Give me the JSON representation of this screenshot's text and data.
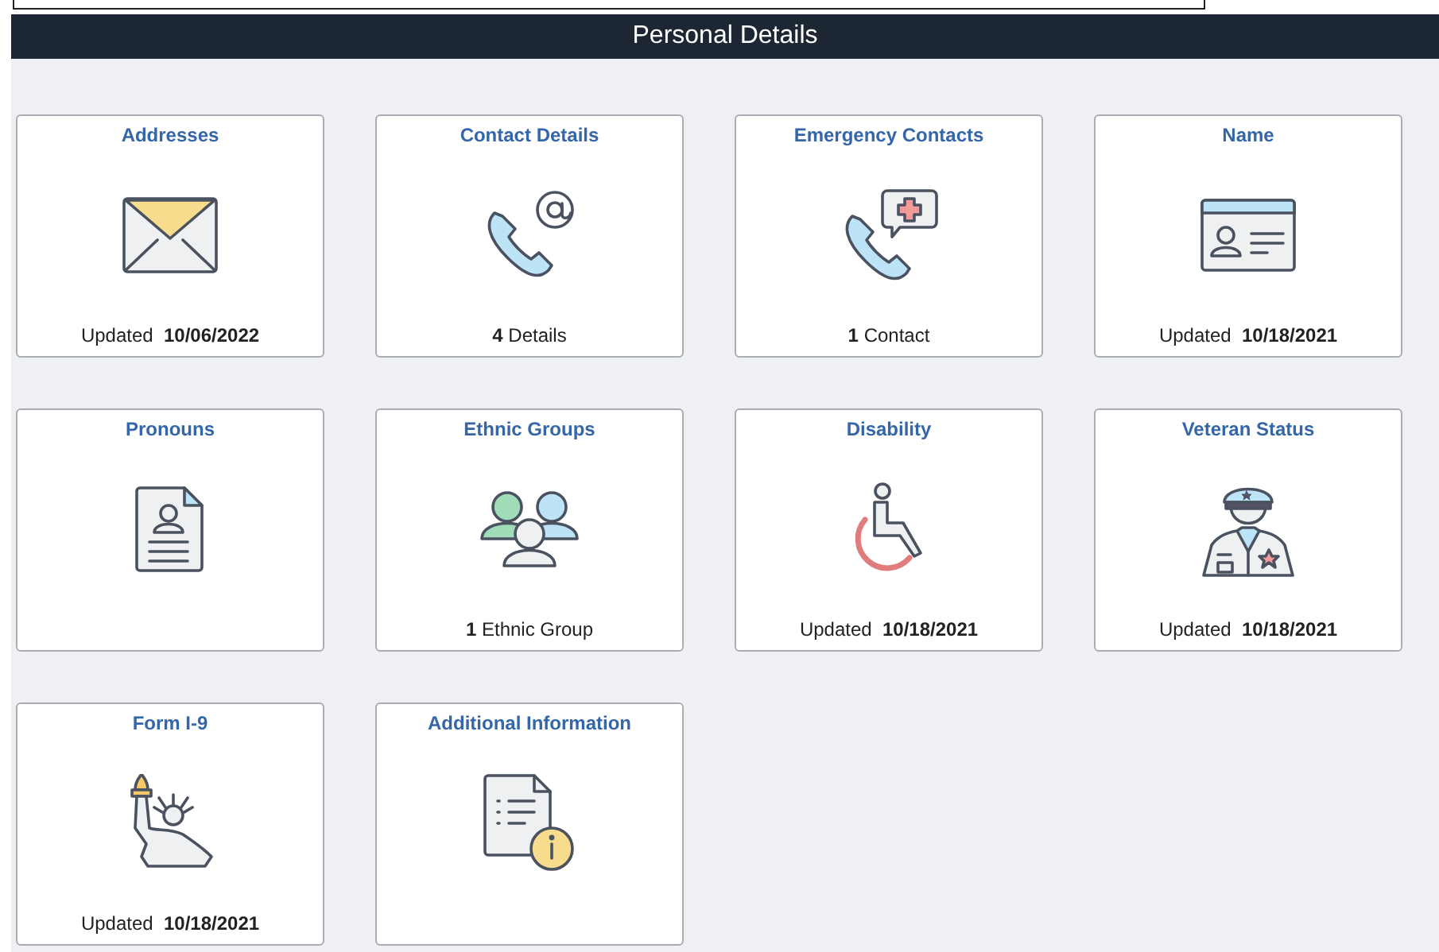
{
  "header": {
    "title": "Personal Details"
  },
  "tiles": [
    {
      "title": "Addresses",
      "footer": "Updated  **10/06/2022**"
    },
    {
      "title": "Contact Details",
      "footer": "**4** Details"
    },
    {
      "title": "Emergency Contacts",
      "footer": "**1** Contact"
    },
    {
      "title": "Name",
      "footer": "Updated  **10/18/2021**"
    },
    {
      "title": "Pronouns"
    },
    {
      "title": "Ethnic Groups",
      "footer": "**1** Ethnic Group"
    },
    {
      "title": "Disability",
      "footer": "Updated  **10/18/2021**"
    },
    {
      "title": "Veteran Status",
      "footer": "Updated  **10/18/2021**"
    },
    {
      "title": "Form I-9",
      "footer": "Updated  **10/18/2021**"
    },
    {
      "title": "Additional Information"
    }
  ]
}
